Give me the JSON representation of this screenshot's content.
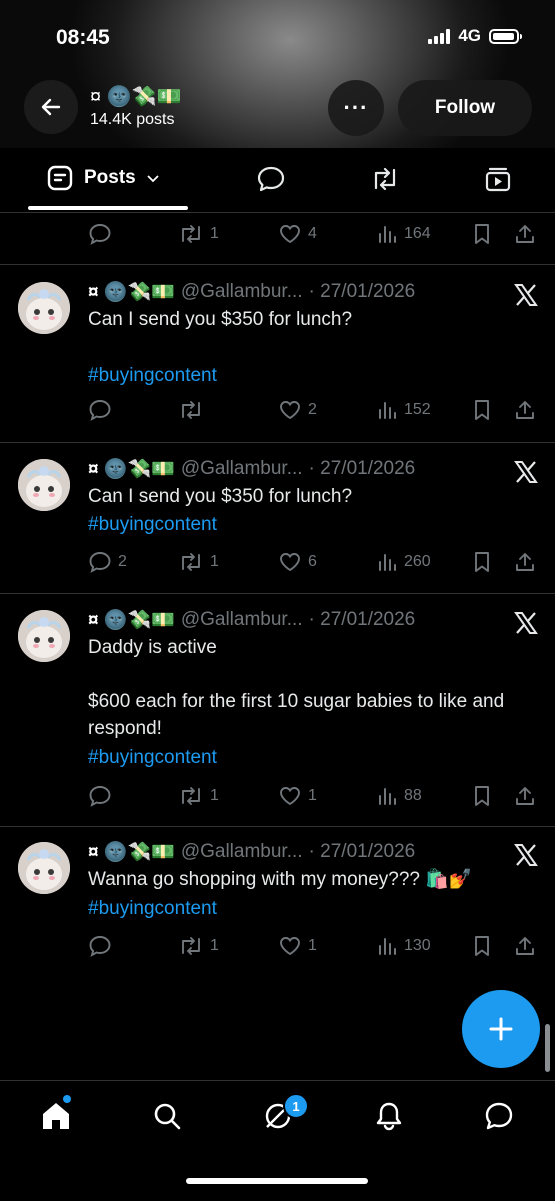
{
  "status_bar": {
    "time": "08:45",
    "network": "4G"
  },
  "header": {
    "display_name": "¤ 🌚💸💵",
    "post_count": "14.4K posts",
    "follow_label": "Follow",
    "more_label": "···"
  },
  "tabs": {
    "active_label": "Posts"
  },
  "top_actions": {
    "reposts": "1",
    "likes": "4",
    "views": "164"
  },
  "posts": [
    {
      "name": "¤ 🌚💸💵",
      "handle": "@Gallambur...",
      "date": "· 27/01/2026",
      "text": "Can I send you $350 for lunch?\n",
      "hashtag": "#buyingcontent",
      "replies": "",
      "reposts": "",
      "likes": "2",
      "views": "152"
    },
    {
      "name": "¤ 🌚💸💵",
      "handle": "@Gallambur...",
      "date": "· 27/01/2026",
      "text": "Can I send you $350 for lunch?",
      "hashtag": "#buyingcontent",
      "replies": "2",
      "reposts": "1",
      "likes": "6",
      "views": "260"
    },
    {
      "name": "¤ 🌚💸💵",
      "handle": "@Gallambur...",
      "date": "· 27/01/2026",
      "text": "Daddy is active\n\n$600 each for the first 10 sugar babies to like and respond!",
      "hashtag": "#buyingcontent",
      "replies": "",
      "reposts": "1",
      "likes": "1",
      "views": "88"
    },
    {
      "name": "¤ 🌚💸💵",
      "handle": "@Gallambur...",
      "date": "· 27/01/2026",
      "text": "Wanna go shopping with my money??? 🛍️💅",
      "hashtag": "#buyingcontent",
      "replies": "",
      "reposts": "1",
      "likes": "1",
      "views": "130"
    }
  ],
  "nav": {
    "messages_badge": "1"
  },
  "colors": {
    "accent": "#1d9bf0",
    "muted": "#71767b",
    "divider": "#2f3336"
  }
}
